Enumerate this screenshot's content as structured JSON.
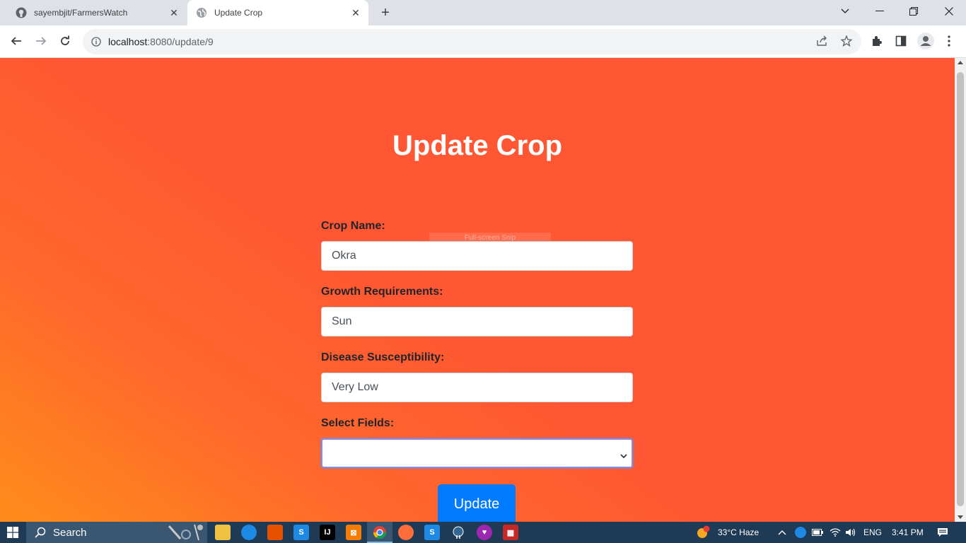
{
  "browser": {
    "tabs": [
      {
        "label": "sayembjit/FarmersWatch",
        "favicon": "github-icon"
      },
      {
        "label": "Update Crop",
        "favicon": "globe-icon",
        "active": true
      }
    ],
    "url_host": "localhost",
    "url_path": ":8080/update/9"
  },
  "page": {
    "title": "Update Crop",
    "fields": {
      "crop_name_label": "Crop Name:",
      "crop_name_value": "Okra",
      "growth_label": "Growth Requirements:",
      "growth_value": "Sun",
      "disease_label": "Disease Susceptibility:",
      "disease_value": "Very Low",
      "select_label": "Select Fields:",
      "select_value": ""
    },
    "submit_label": "Update",
    "ghost_text": "Full-screen Snip"
  },
  "taskbar": {
    "search_label": "Search",
    "weather": "33°C  Haze",
    "language": "ENG",
    "time": "3:41 PM"
  },
  "colors": {
    "gradient_main": "#ff5733",
    "gradient_corner": "#ff8c1a",
    "button": "#007bff"
  }
}
